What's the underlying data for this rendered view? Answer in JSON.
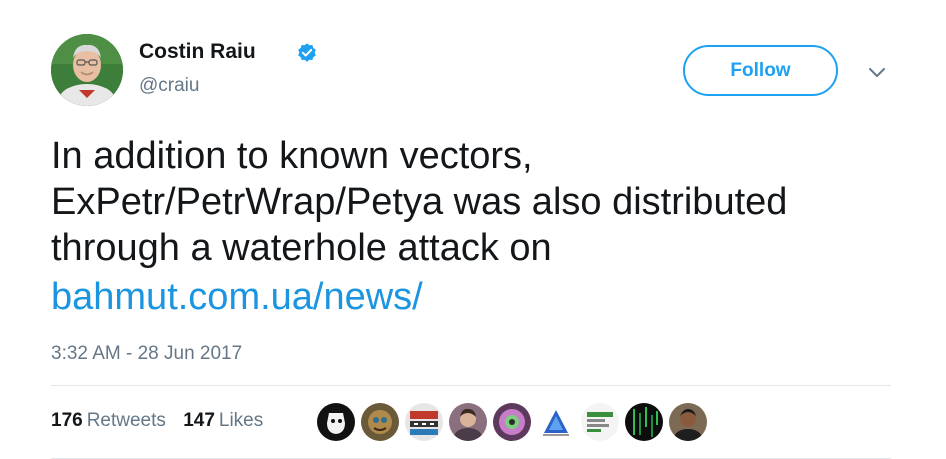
{
  "author": {
    "name": "Costin Raiu",
    "handle": "@craiu",
    "avatar_icon": "person-photo-avatar",
    "verified_icon": "verified-badge-icon"
  },
  "follow_button": {
    "label": "Follow"
  },
  "menu_icon": "chevron-down-icon",
  "tweet": {
    "text_lines": [
      "In addition to known vectors,",
      "ExPetr/PetrWrap/Petya was also distributed",
      "through a waterhole attack on"
    ],
    "link": "bahmut.com.ua/news/"
  },
  "timestamp": "3:32 AM - 28 Jun 2017",
  "stats": {
    "retweets_count": "176",
    "retweets_label": "Retweets",
    "likes_count": "147",
    "likes_label": "Likes"
  },
  "likers": [
    {
      "icon": "liker-avatar-1"
    },
    {
      "icon": "liker-avatar-2"
    },
    {
      "icon": "liker-avatar-3"
    },
    {
      "icon": "liker-avatar-4"
    },
    {
      "icon": "liker-avatar-5"
    },
    {
      "icon": "liker-avatar-6"
    },
    {
      "icon": "liker-avatar-7"
    },
    {
      "icon": "liker-avatar-8"
    },
    {
      "icon": "liker-avatar-9"
    }
  ],
  "colors": {
    "accent": "#1da1f2",
    "link": "#1b95e0",
    "text": "#14171a",
    "muted": "#657786",
    "divider": "#e1e8ed"
  }
}
